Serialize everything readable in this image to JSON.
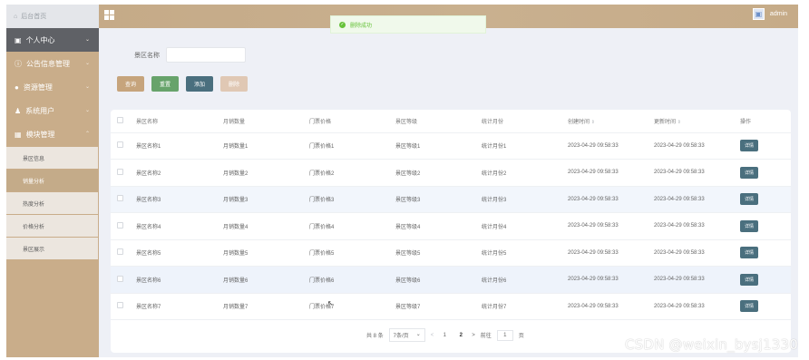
{
  "header": {
    "home_label": "后台首页",
    "system_title": "",
    "username": "admin"
  },
  "toast": {
    "message": "删除成功",
    "icon": "check-circle-icon",
    "color": "#67c23a"
  },
  "sidebar": {
    "items": [
      {
        "label": "个人中心",
        "icon": "user-icon"
      },
      {
        "label": "公告信息管理",
        "icon": "info-icon"
      },
      {
        "label": "资源管理",
        "icon": "pin-icon"
      },
      {
        "label": "系统用户",
        "icon": "person-icon"
      },
      {
        "label": "模块管理",
        "icon": "grid-icon"
      }
    ],
    "sub_items": [
      {
        "label": "景区信息",
        "active": false
      },
      {
        "label": "销量分析",
        "active": true
      },
      {
        "label": "热度分析",
        "active": false
      },
      {
        "label": "价格分析",
        "active": false
      },
      {
        "label": "景区展示",
        "active": false
      }
    ]
  },
  "search": {
    "label": "景区名称",
    "placeholder": "",
    "value": ""
  },
  "buttons": {
    "query": "查询",
    "reset": "重置",
    "add": "添加",
    "delete": "删除"
  },
  "table": {
    "columns": [
      "景区名称",
      "月销数量",
      "门票价格",
      "景区等级",
      "统计月份",
      "创建时间",
      "更新时间",
      "操作"
    ],
    "rows": [
      [
        "景区名称1",
        "月销数量1",
        "门票价格1",
        "景区等级1",
        "统计月份1",
        "2023-04-29 09:58:33",
        "2023-04-29 09:58:33"
      ],
      [
        "景区名称2",
        "月销数量2",
        "门票价格2",
        "景区等级2",
        "统计月份2",
        "2023-04-29 09:58:33",
        "2023-04-29 09:58:33"
      ],
      [
        "景区名称3",
        "月销数量3",
        "门票价格3",
        "景区等级3",
        "统计月份3",
        "2023-04-29 09:58:33",
        "2023-04-29 09:58:33"
      ],
      [
        "景区名称4",
        "月销数量4",
        "门票价格4",
        "景区等级4",
        "统计月份4",
        "2023-04-29 09:58:33",
        "2023-04-29 09:58:33"
      ],
      [
        "景区名称5",
        "月销数量5",
        "门票价格5",
        "景区等级5",
        "统计月份5",
        "2023-04-29 09:58:33",
        "2023-04-29 09:58:33"
      ],
      [
        "景区名称6",
        "月销数量6",
        "门票价格6",
        "景区等级6",
        "统计月份6",
        "2023-04-29 09:58:33",
        "2023-04-29 09:58:33"
      ],
      [
        "景区名称7",
        "月销数量7",
        "门票价格7",
        "景区等级7",
        "统计月份7",
        "2023-04-29 09:58:33",
        "2023-04-29 09:58:33"
      ]
    ],
    "action_label": "详情",
    "sort_indicator": "⇕"
  },
  "pagination": {
    "total": "共 8 条",
    "page_size": "7条/页",
    "prev": "<",
    "pages": [
      "1",
      "2"
    ],
    "next": ">",
    "goto_label": "前往",
    "goto_value": "1",
    "goto_suffix": "页"
  },
  "watermark": "CSDN @weixin_bysj1330",
  "colors": {
    "accent": "#c6a47c",
    "sidebar": "#c9ad8a",
    "detail_button": "#4a6f7e",
    "success": "#67c23a"
  }
}
